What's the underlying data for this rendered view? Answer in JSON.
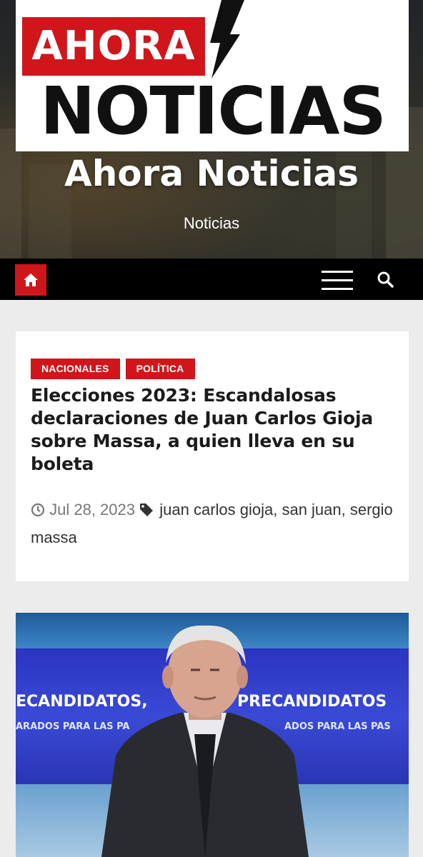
{
  "header": {
    "logo_line1": "AHORA",
    "logo_line2": "NOTICIAS",
    "site_title": "Ahora Noticias",
    "site_description": "Noticias"
  },
  "nav": {
    "home_icon": "home-icon",
    "menu_icon": "hamburger-menu-icon",
    "search_icon": "search-icon"
  },
  "article": {
    "categories": [
      "NACIONALES",
      "POLÍTICA"
    ],
    "title": "Elecciones 2023: Escandalosas declaraciones de Juan Carlos Gioja sobre Massa, a quien lleva en su boleta",
    "date": "Jul 28, 2023",
    "tags": "juan carlos gioja, san juan, sergio massa",
    "image": {
      "screen_text_left": "ECANDIDATOS,",
      "screen_text_right": "PRECANDIDATOS",
      "screen_sub_left": "ARADOS PARA LAS PA",
      "screen_sub_right": "ADOS PARA LAS PAS"
    }
  },
  "colors": {
    "accent": "#d0161b",
    "nav_bg": "#000000",
    "page_bg": "#ececec"
  }
}
